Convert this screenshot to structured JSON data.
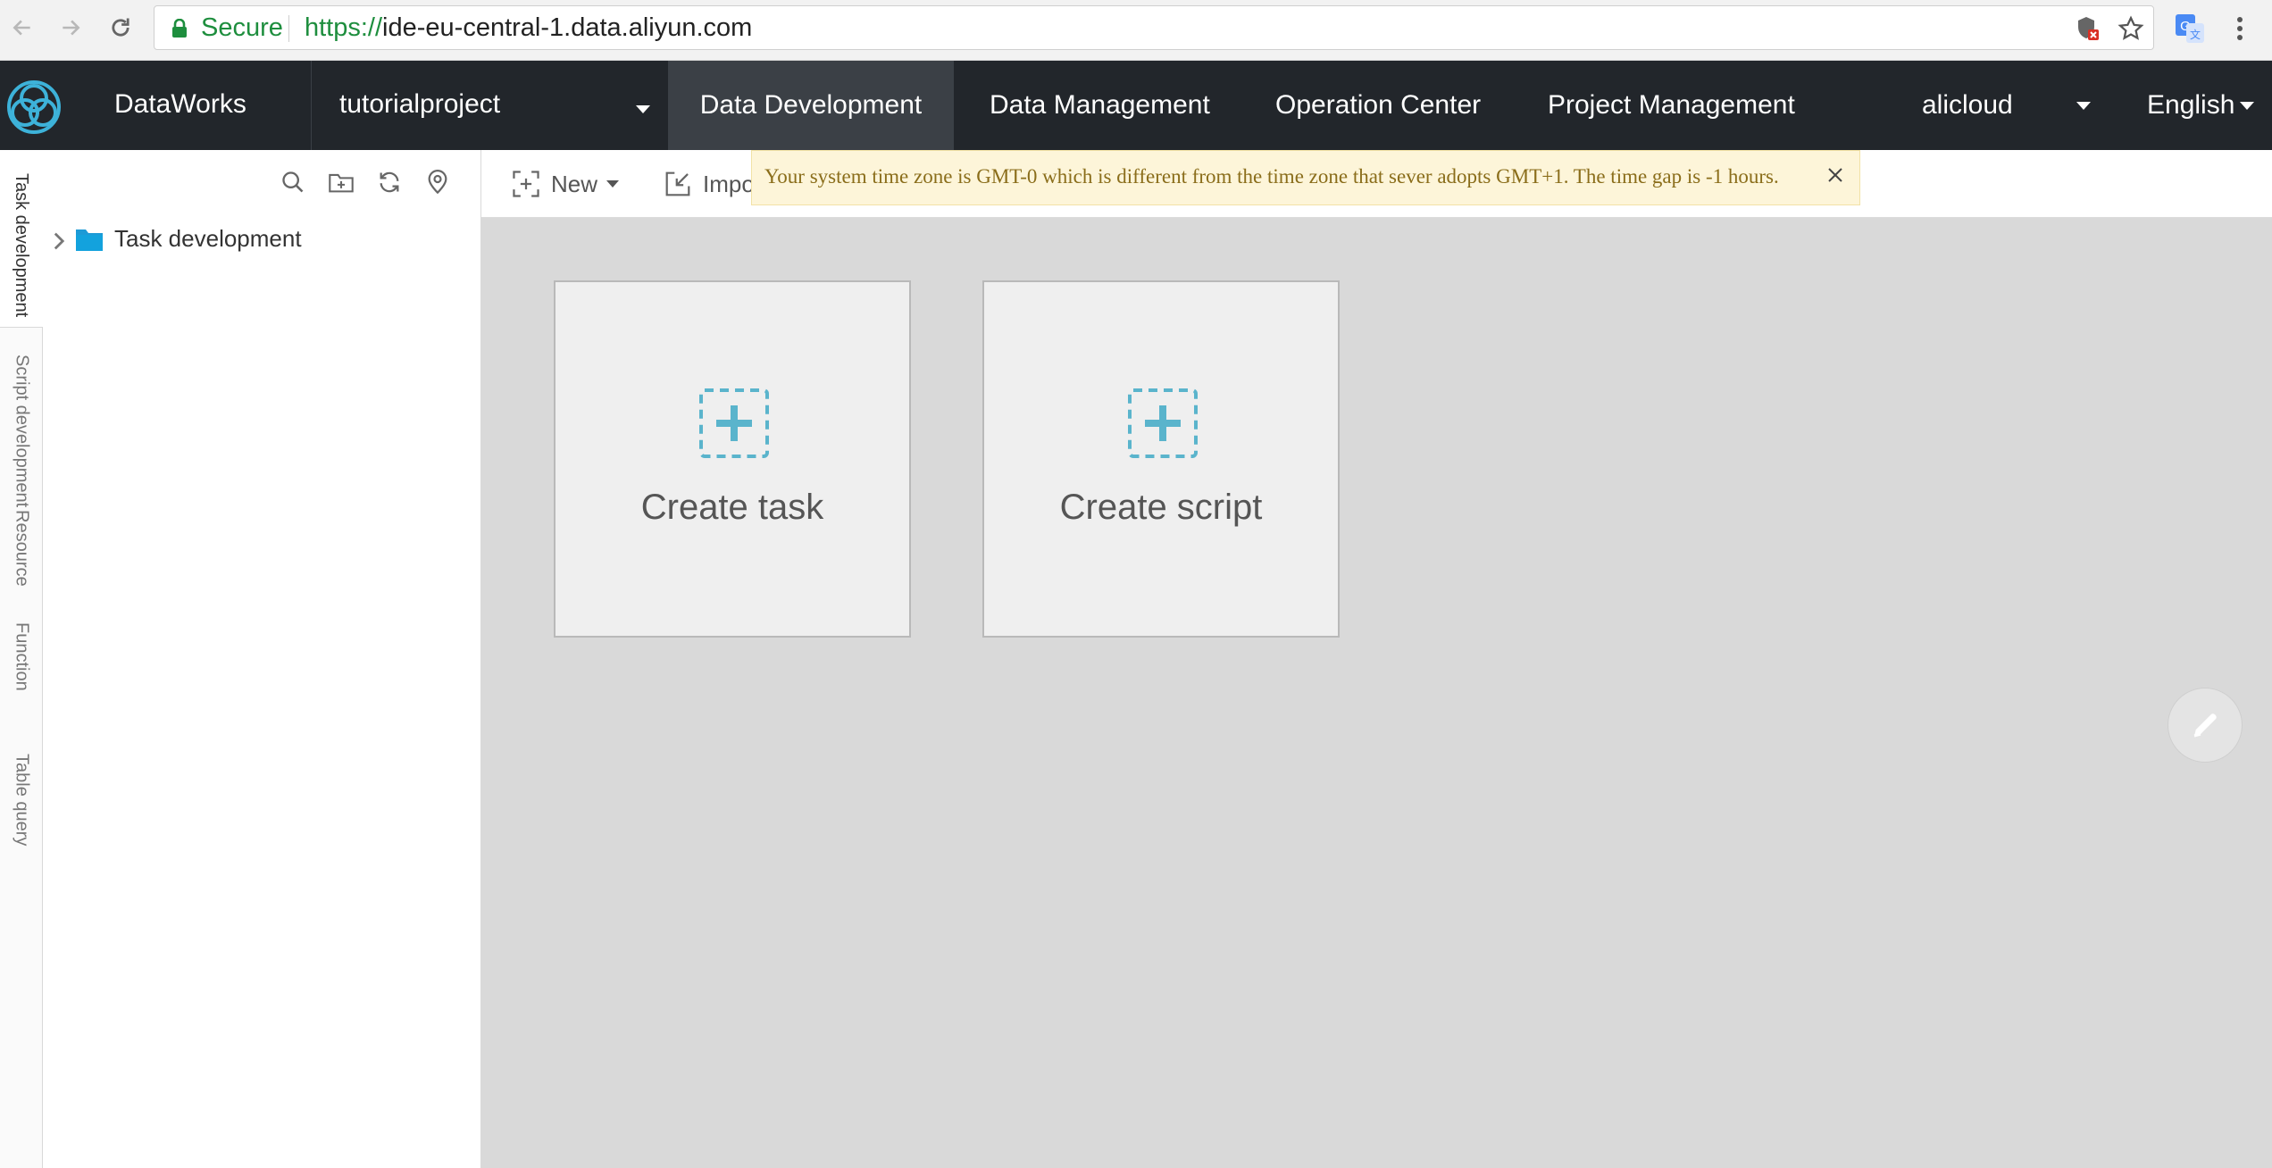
{
  "browser": {
    "secure_label": "Secure",
    "url_scheme": "https://",
    "url_rest": "ide-eu-central-1.data.aliyun.com"
  },
  "header": {
    "brand": "DataWorks",
    "project": "tutorialproject",
    "menus": [
      {
        "label": "Data Development",
        "active": true
      },
      {
        "label": "Data Management"
      },
      {
        "label": "Operation Center"
      },
      {
        "label": "Project Management"
      }
    ],
    "user": "alicloud",
    "language": "English"
  },
  "rail": {
    "tabs": [
      "Task development",
      "Script development",
      "Resource",
      "Function",
      "Table query"
    ]
  },
  "tree": {
    "root_label": "Task development"
  },
  "toolbar": {
    "new_label": "New",
    "import_label": "Impo"
  },
  "notice": {
    "text": "Your system time zone is GMT-0 which is different from the time zone that sever adopts GMT+1. The time gap is -1 hours."
  },
  "cards": {
    "create_task": "Create task",
    "create_script": "Create script"
  },
  "colors": {
    "header_bg": "#22262b",
    "accent": "#5ab4cc",
    "secure_green": "#1e8e3e",
    "notice_bg": "#fdf5d9"
  }
}
